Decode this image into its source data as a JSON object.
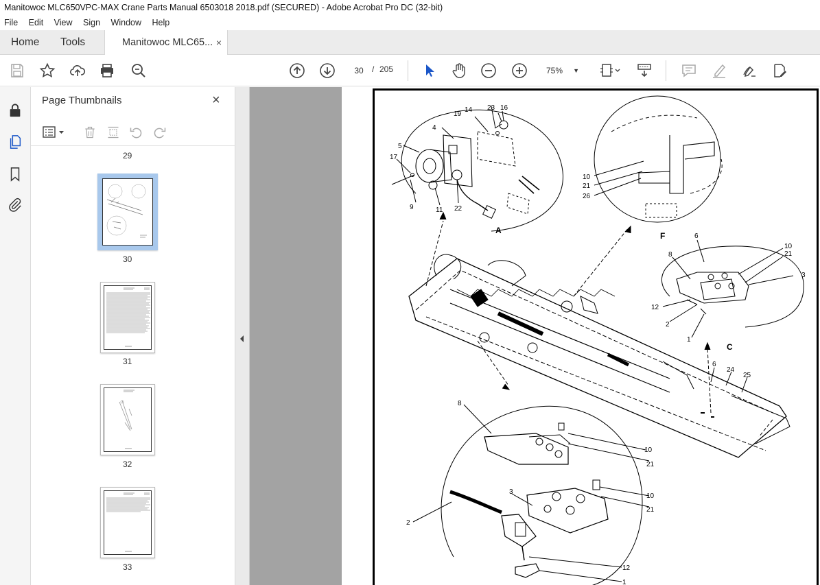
{
  "window": {
    "title": "Manitowoc MLC650VPC-MAX Crane Parts Manual 6503018 2018.pdf (SECURED) - Adobe Acrobat Pro DC (32-bit)"
  },
  "menu": [
    "File",
    "Edit",
    "View",
    "Sign",
    "Window",
    "Help"
  ],
  "tabs": {
    "home": "Home",
    "tools": "Tools",
    "doc": "Manitowoc MLC65...",
    "close": "×"
  },
  "toolbar": {
    "page_current": "30",
    "page_sep": "/",
    "page_total": "205",
    "zoom": "75%",
    "zoom_caret": "▼"
  },
  "panel": {
    "title": "Page Thumbnails",
    "close": "×"
  },
  "thumbnails": [
    {
      "label": "29"
    },
    {
      "label": "30",
      "selected": true
    },
    {
      "label": "31"
    },
    {
      "label": "32"
    },
    {
      "label": "33"
    }
  ],
  "drawing": {
    "details": [
      "A",
      "F",
      "C"
    ],
    "callouts_a": [
      "23",
      "16",
      "14",
      "19",
      "4",
      "5",
      "17",
      "9",
      "11",
      "22"
    ],
    "callouts_f": [
      "10",
      "21",
      "26"
    ],
    "callouts_c": [
      "6",
      "8",
      "10",
      "21",
      "3",
      "12",
      "2",
      "1"
    ],
    "callouts_main": [
      "6",
      "24",
      "25"
    ],
    "callouts_bottom": [
      "8",
      "10",
      "21",
      "3",
      "10",
      "21",
      "2",
      "12",
      "1"
    ]
  }
}
